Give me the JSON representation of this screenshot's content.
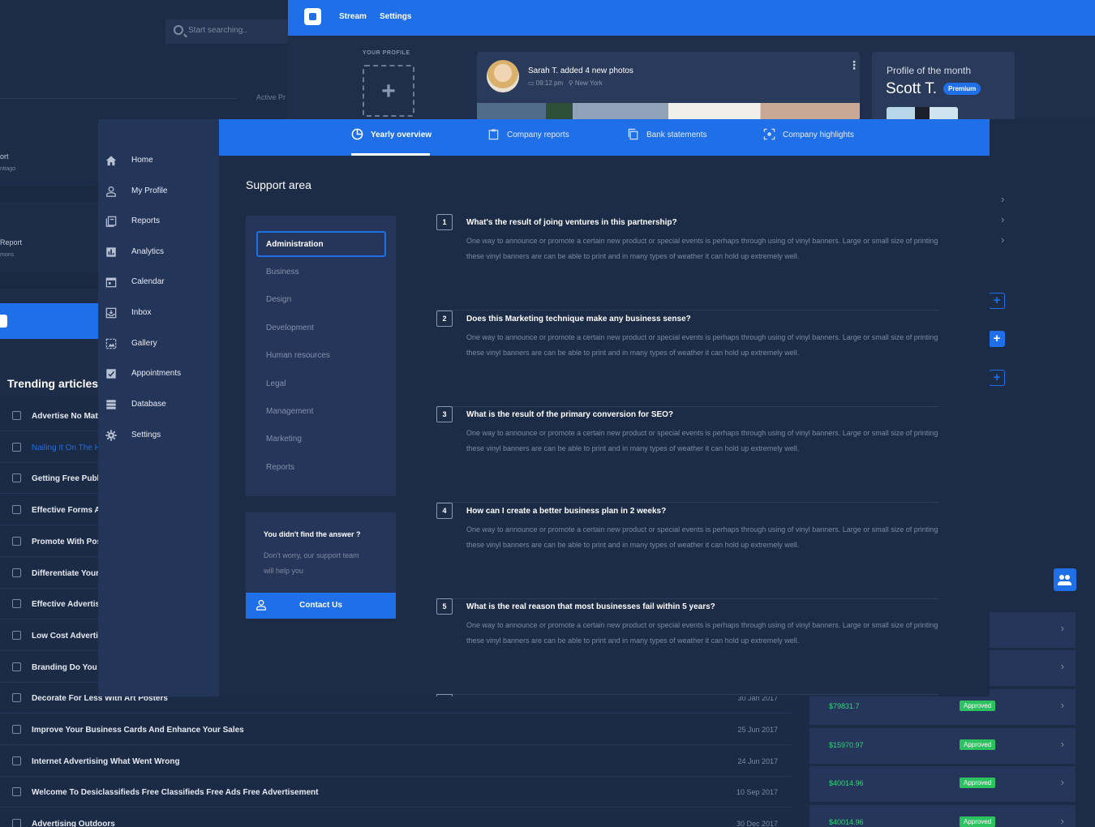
{
  "back_left": {
    "search_placeholder": "Start searching..",
    "active_label": "Active Pr",
    "rows": [
      {
        "title": "ort",
        "sub": "ntiago"
      },
      {
        "title": "Report",
        "sub": "mons"
      }
    ],
    "trending_title": "Trending articles"
  },
  "top_window": {
    "nav": [
      "Stream",
      "Settings"
    ],
    "your_profile": "YOUR PROFILE",
    "post": {
      "author": "Sarah T.",
      "action": "added 4 new photos",
      "time": "09:12 pm",
      "location": "New York"
    },
    "profile_of_month": {
      "title": "Profile of the month",
      "name": "Scott T.",
      "badge": "Premium"
    }
  },
  "sidebar": {
    "items": [
      {
        "label": "Home",
        "icon": "home-icon"
      },
      {
        "label": "My Profile",
        "icon": "user-icon"
      },
      {
        "label": "Reports",
        "icon": "reports-icon"
      },
      {
        "label": "Analytics",
        "icon": "analytics-icon"
      },
      {
        "label": "Calendar",
        "icon": "calendar-icon"
      },
      {
        "label": "Inbox",
        "icon": "inbox-icon"
      },
      {
        "label": "Gallery",
        "icon": "gallery-icon"
      },
      {
        "label": "Appointments",
        "icon": "check-icon"
      },
      {
        "label": "Database",
        "icon": "database-icon"
      },
      {
        "label": "Settings",
        "icon": "gear-icon"
      }
    ]
  },
  "tabs": [
    {
      "label": "Yearly overview",
      "icon": "chart-pie-icon",
      "active": true
    },
    {
      "label": "Company reports",
      "icon": "clipboard-icon",
      "active": false
    },
    {
      "label": "Bank statements",
      "icon": "copy-icon",
      "active": false
    },
    {
      "label": "Company highlights",
      "icon": "focus-icon",
      "active": false
    }
  ],
  "support": {
    "title": "Support area",
    "categories": [
      "Administration",
      "Business",
      "Design",
      "Development",
      "Human resources",
      "Legal",
      "Management",
      "Marketing",
      "Reports"
    ],
    "help": {
      "title": "You didn't find the answer ?",
      "text": "Don't worry, our support team will help you",
      "button": "Contact Us"
    },
    "faqs": [
      {
        "num": "1",
        "q": "What's the result of joing ventures in this partnership?",
        "a": "One way to announce or promote a certain new product or special events is perhaps through using of vinyl banners. Large or small size of printing these vinyl banners are can be able to print and in many types of weather it can hold up extremely well."
      },
      {
        "num": "2",
        "q": "Does this Marketing technique make any business sense?",
        "a": "One way to announce or promote a certain new product or special events is perhaps through using of vinyl banners. Large or small size of printing these vinyl banners are can be able to print and in many types of weather it can hold up extremely well."
      },
      {
        "num": "3",
        "q": "What is the result of the primary conversion for SEO?",
        "a": "One way to announce or promote a certain new product or special events is perhaps through using of vinyl banners. Large or small size of printing these vinyl banners are can be able to print and in many types of weather it can hold up extremely well."
      },
      {
        "num": "4",
        "q": "How can I create a better business plan in 2 weeks?",
        "a": "One way to announce or promote a certain new product or special events is perhaps through using of vinyl banners. Large or small size of printing these vinyl banners are can be able to print and in many types of weather it can hold up extremely well."
      },
      {
        "num": "5",
        "q": "What is the real reason that most businesses fail within 5 years?",
        "a": "One way to announce or promote a certain new product or special events is perhaps through using of vinyl banners. Large or small size of printing these vinyl banners are can be able to print and in many types of weather it can hold up extremely well."
      }
    ]
  },
  "articles": [
    {
      "title": "Advertise No Matt",
      "date": "",
      "highlight": false
    },
    {
      "title": "Nailing It On The H",
      "date": "",
      "highlight": true
    },
    {
      "title": "Getting Free Publi",
      "date": "",
      "highlight": false
    },
    {
      "title": "Effective Forms Ad",
      "date": "",
      "highlight": false
    },
    {
      "title": "Promote With Pos",
      "date": "",
      "highlight": false
    },
    {
      "title": "Differentiate Your",
      "date": "",
      "highlight": false
    },
    {
      "title": "Effective Advertisi",
      "date": "",
      "highlight": false
    },
    {
      "title": "Low Cost Advertisi",
      "date": "",
      "highlight": false
    },
    {
      "title": "Branding Do You K",
      "date": "",
      "highlight": false
    },
    {
      "title": "Decorate For Less With Art Posters",
      "date": "30 Jan 2017",
      "highlight": false
    },
    {
      "title": "Improve Your Business Cards And Enhance Your Sales",
      "date": "25 Jun 2017",
      "highlight": false
    },
    {
      "title": "Internet Advertising What Went Wrong",
      "date": "24 Jun 2017",
      "highlight": false
    },
    {
      "title": "Welcome To Desiclassifieds Free Classifieds Free Ads Free Advertisement",
      "date": "10 Sep 2017",
      "highlight": false
    },
    {
      "title": "Advertising Outdoors",
      "date": "30 Dec 2017",
      "highlight": false
    }
  ],
  "payments": [
    {
      "amount": "$79831.7",
      "status": "Approved"
    },
    {
      "amount": "$15970.97",
      "status": "Approved"
    },
    {
      "amount": "$40014.96",
      "status": "Approved"
    },
    {
      "amount": "$40014.96",
      "status": "Approved"
    }
  ],
  "colors": {
    "accent": "#1f6fe8",
    "bg": "#1c2b46",
    "panel": "#26365a",
    "success": "#2cc25f"
  }
}
